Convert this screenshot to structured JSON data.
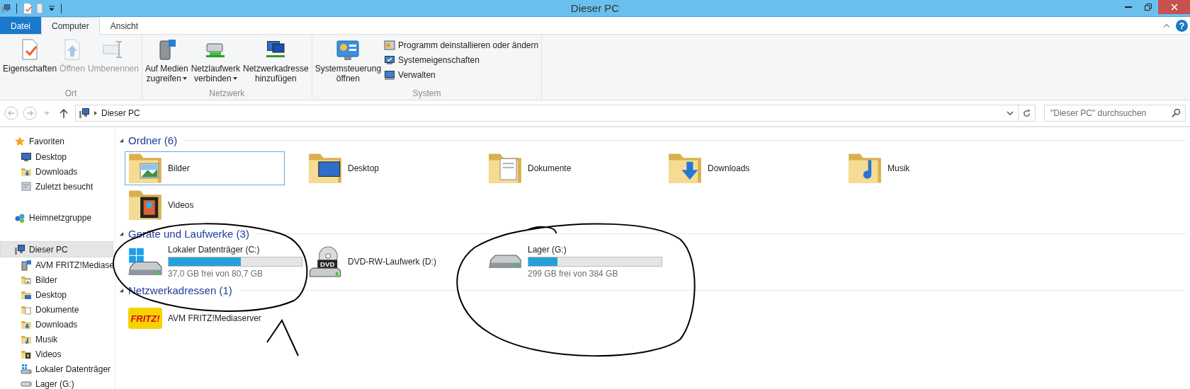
{
  "window": {
    "title": "Dieser PC"
  },
  "ribbon_tabs": [
    {
      "label": "Datei",
      "kind": "file",
      "selected": false
    },
    {
      "label": "Computer",
      "kind": "tab",
      "selected": true
    },
    {
      "label": "Ansicht",
      "kind": "tab",
      "selected": false
    }
  ],
  "help": "?",
  "ribbon_groups": [
    {
      "label": "Ort",
      "buttons": [
        {
          "lines": [
            "Eigenschaften"
          ],
          "disabled": false,
          "dropdown": false
        },
        {
          "lines": [
            "Öffnen"
          ],
          "disabled": true,
          "dropdown": false
        },
        {
          "lines": [
            "Umbenennen"
          ],
          "disabled": true,
          "dropdown": false
        }
      ]
    },
    {
      "label": "Netzwerk",
      "buttons": [
        {
          "lines": [
            "Auf Medien",
            "zugreifen"
          ],
          "disabled": false,
          "dropdown": true
        },
        {
          "lines": [
            "Netzlaufwerk",
            "verbinden"
          ],
          "disabled": false,
          "dropdown": true
        },
        {
          "lines": [
            "Netzwerkadresse",
            "hinzufügen"
          ],
          "disabled": false,
          "dropdown": false
        }
      ]
    },
    {
      "label": "System",
      "buttons": [
        {
          "lines": [
            "Systemsteuerung",
            "öffnen"
          ],
          "disabled": false,
          "dropdown": false
        }
      ],
      "links": [
        "Programm deinstallieren oder ändern",
        "Systemeigenschaften",
        "Verwalten"
      ]
    }
  ],
  "address": {
    "path": "Dieser PC"
  },
  "search": {
    "placeholder": "\"Dieser PC\" durchsuchen"
  },
  "sidebar": [
    {
      "label": "Favoriten",
      "selected": false,
      "children": [
        {
          "label": "Desktop"
        },
        {
          "label": "Downloads"
        },
        {
          "label": "Zuletzt besucht"
        }
      ]
    },
    {
      "label": "Heimnetzgruppe",
      "selected": false
    },
    {
      "label": "Dieser PC",
      "selected": true,
      "children": [
        {
          "label": "AVM FRITZ!Mediase"
        },
        {
          "label": "Bilder"
        },
        {
          "label": "Desktop"
        },
        {
          "label": "Dokumente"
        },
        {
          "label": "Downloads"
        },
        {
          "label": "Musik"
        },
        {
          "label": "Videos"
        },
        {
          "label": "Lokaler Datenträger"
        },
        {
          "label": "Lager (G:)"
        }
      ]
    }
  ],
  "groups": [
    {
      "title": "Ordner (6)",
      "expanded": true,
      "items": [
        {
          "kind": "folder",
          "name": "Bilder",
          "selected": true
        },
        {
          "kind": "folder",
          "name": "Desktop",
          "selected": false
        },
        {
          "kind": "folder",
          "name": "Dokumente",
          "selected": false
        },
        {
          "kind": "folder",
          "name": "Downloads",
          "selected": false
        },
        {
          "kind": "folder",
          "name": "Musik",
          "selected": false
        },
        {
          "kind": "folder",
          "name": "Videos",
          "selected": false
        }
      ]
    },
    {
      "title": "Geräte und Laufwerke (3)",
      "expanded": true,
      "items": [
        {
          "kind": "drive",
          "name": "Lokaler Datenträger (C:)",
          "level": 0.54,
          "free": "37,0 GB frei von 80,7 GB",
          "selected": false
        },
        {
          "kind": "optical",
          "name": "DVD-RW-Laufwerk (D:)",
          "badge": "DVD",
          "selected": false
        },
        {
          "kind": "drive",
          "name": "Lager (G:)",
          "level": 0.22,
          "free": "299 GB frei von 384 GB",
          "selected": false
        }
      ]
    },
    {
      "title": "Netzwerkadressen (1)",
      "expanded": true,
      "items": [
        {
          "kind": "server",
          "name": "AVM FRITZ!Mediaserver",
          "logo": "FRITZ!",
          "selected": false
        }
      ]
    }
  ]
}
